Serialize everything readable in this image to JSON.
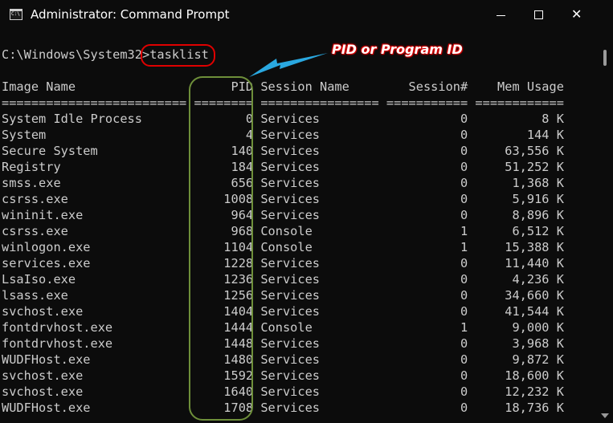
{
  "titlebar": {
    "title": "Administrator: Command Prompt",
    "icon": "console-icon",
    "icon_text": "C:\\",
    "buttons": [
      "minimize",
      "maximize",
      "close"
    ],
    "close_glyph": "✕"
  },
  "console": {
    "prompt": "C:\\Windows\\System32>",
    "command": "tasklist",
    "header": "Image Name                     PID Session Name        Session#    Mem Usage",
    "separator": "========================= ======== ================ =========== ============",
    "rows": [
      "System Idle Process              0 Services                   0          8 K",
      "System                           4 Services                   0        144 K",
      "Secure System                  140 Services                   0     63,556 K",
      "Registry                       184 Services                   0     51,252 K",
      "smss.exe                       656 Services                   0      1,368 K",
      "csrss.exe                     1008 Services                   0      5,916 K",
      "wininit.exe                    964 Services                   0      8,896 K",
      "csrss.exe                      968 Console                    1      6,512 K",
      "winlogon.exe                  1104 Console                    1     15,388 K",
      "services.exe                  1228 Services                   0     11,440 K",
      "LsaIso.exe                    1236 Services                   0      4,236 K",
      "lsass.exe                     1256 Services                   0     34,660 K",
      "svchost.exe                   1404 Services                   0     41,544 K",
      "fontdrvhost.exe               1444 Console                    1      9,000 K",
      "fontdrvhost.exe               1448 Services                   0      3,968 K",
      "WUDFHost.exe                  1480 Services                   0      9,872 K",
      "svchost.exe                   1592 Services                   0     18,600 K",
      "svchost.exe                   1640 Services                   0     12,232 K",
      "WUDFHost.exe                  1708 Services                   0     18,736 K"
    ]
  },
  "annotation": {
    "label": "PID or Program  ID",
    "colors": {
      "command_ring": "#e00000",
      "pid_column_ring": "#6e8f3a",
      "arrow": "#2aa8e0",
      "label_outline": "#d40000"
    }
  },
  "colors": {
    "background": "#0c0c0c",
    "text": "#cccccc",
    "title_text": "#ffffff"
  }
}
